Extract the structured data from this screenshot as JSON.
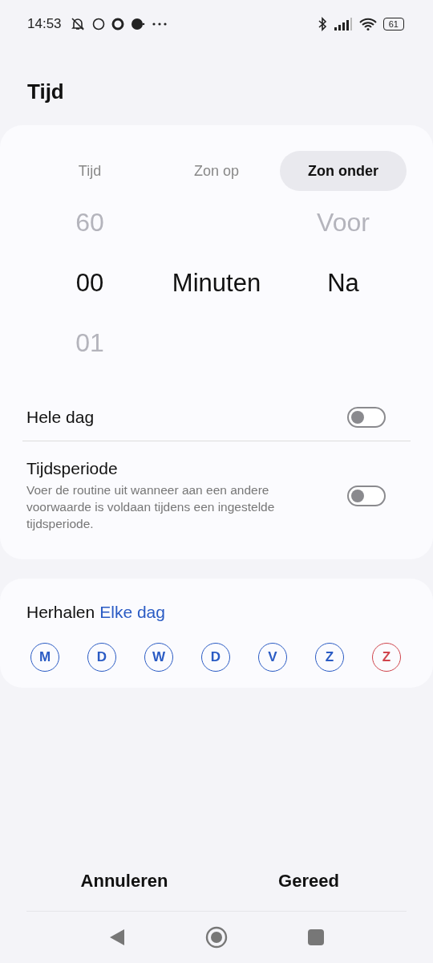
{
  "status_bar": {
    "time": "14:53",
    "battery": "61"
  },
  "title": "Tijd",
  "tabs": [
    {
      "label": "Tijd",
      "selected": false
    },
    {
      "label": "Zon op",
      "selected": false
    },
    {
      "label": "Zon onder",
      "selected": true
    }
  ],
  "picker": [
    {
      "above": "60",
      "current": "00",
      "below": "01"
    },
    {
      "current": "Minuten"
    },
    {
      "above": "Voor",
      "current": "Na"
    }
  ],
  "settings": [
    {
      "label": "Hele dag",
      "on": false
    },
    {
      "label": "Tijdsperiode",
      "description": "Voer de routine uit wanneer aan een andere voorwaarde is voldaan tijdens een ingestelde tijdsperiode.",
      "on": false
    }
  ],
  "repeat": {
    "label": "Herhalen",
    "value": "Elke dag"
  },
  "days": [
    {
      "letter": "M",
      "color": "#2a5bc4"
    },
    {
      "letter": "D",
      "color": "#2a5bc4"
    },
    {
      "letter": "W",
      "color": "#2a5bc4"
    },
    {
      "letter": "D",
      "color": "#2a5bc4"
    },
    {
      "letter": "V",
      "color": "#2a5bc4"
    },
    {
      "letter": "Z",
      "color": "#2a5bc4"
    },
    {
      "letter": "Z",
      "color": "#d0444c"
    }
  ],
  "buttons": [
    "Annuleren",
    "Gereed"
  ]
}
